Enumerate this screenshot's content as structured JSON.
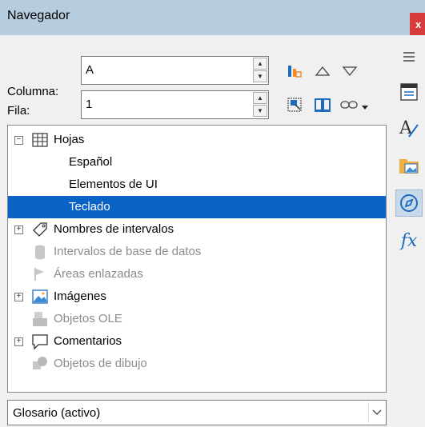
{
  "window": {
    "title": "Navegador",
    "close_label": "x"
  },
  "fields": {
    "column_label": "Columna:",
    "column_value": "A",
    "row_label": "Fila:",
    "row_value": "1"
  },
  "tree": {
    "items": [
      {
        "label": "Hojas",
        "level": 0,
        "expander": "minus",
        "icon": "sheets-grid-icon",
        "state": "normal"
      },
      {
        "label": "Español",
        "level": 1,
        "state": "normal"
      },
      {
        "label": "Elementos de UI",
        "level": 1,
        "state": "normal"
      },
      {
        "label": "Teclado",
        "level": 1,
        "state": "selected"
      },
      {
        "label": "Nombres de intervalos",
        "level": 0,
        "expander": "plus",
        "icon": "tag-icon",
        "state": "normal"
      },
      {
        "label": "Intervalos de base de datos",
        "level": 0,
        "icon": "database-icon",
        "state": "disabled"
      },
      {
        "label": "Áreas enlazadas",
        "level": 0,
        "icon": "flag-icon",
        "state": "disabled"
      },
      {
        "label": "Imágenes",
        "level": 0,
        "expander": "plus",
        "icon": "image-icon",
        "state": "normal"
      },
      {
        "label": "Objetos OLE",
        "level": 0,
        "icon": "ole-object-icon",
        "state": "disabled"
      },
      {
        "label": "Comentarios",
        "level": 0,
        "expander": "plus",
        "icon": "comment-icon",
        "state": "normal"
      },
      {
        "label": "Objetos de dibujo",
        "level": 0,
        "icon": "drawing-objects-icon",
        "state": "disabled"
      }
    ]
  },
  "document_select": {
    "value": "Glosario (activo)"
  },
  "sidebar": {
    "icons": [
      "menu-icon",
      "properties-icon",
      "styles-icon",
      "gallery-icon",
      "navigator-icon",
      "functions-icon"
    ],
    "functions_label": "fx"
  },
  "colors": {
    "titlebar": "#b6cde0",
    "selection": "#0a64c8",
    "close": "#d83b3b",
    "accent": "#1e6cc0"
  }
}
